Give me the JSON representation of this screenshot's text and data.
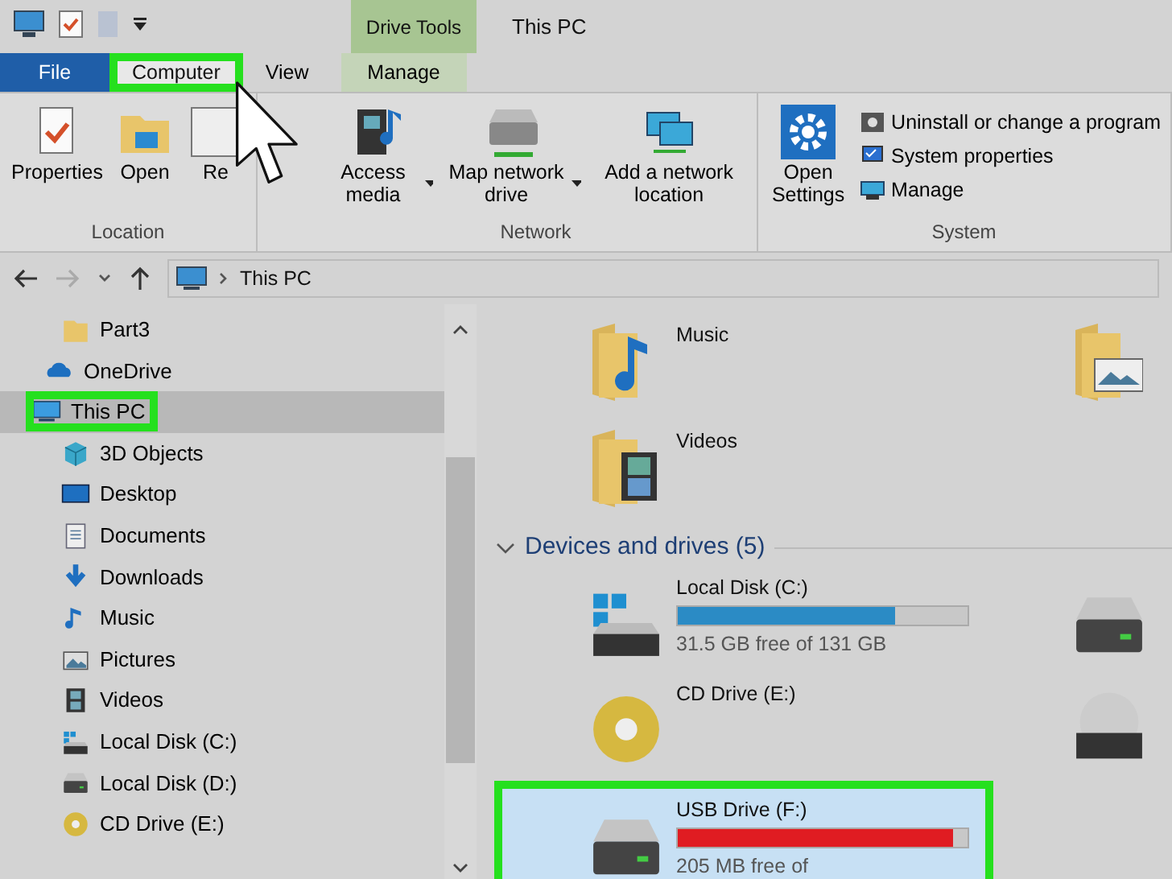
{
  "window": {
    "title": "This PC",
    "context_tab_group": "Drive Tools"
  },
  "tabs": [
    {
      "label": "File",
      "kind": "file",
      "selected": false,
      "highlighted": false
    },
    {
      "label": "Computer",
      "kind": "tab",
      "selected": true,
      "highlighted": true
    },
    {
      "label": "View",
      "kind": "tab",
      "selected": false,
      "highlighted": false
    },
    {
      "label": "Manage",
      "kind": "context",
      "selected": false,
      "highlighted": false
    }
  ],
  "ribbon": [
    {
      "name": "Location",
      "buttons": [
        {
          "label": "Properties",
          "kind": "properties"
        },
        {
          "label": "Open",
          "kind": "open"
        },
        {
          "label": "Re",
          "kind": "recent"
        }
      ]
    },
    {
      "name": "Network",
      "buttons": [
        {
          "label": "Access media",
          "kind": "media",
          "dropdown": true
        },
        {
          "label": "Map network drive",
          "kind": "netdrive",
          "dropdown": true
        },
        {
          "label": "Add a network location",
          "kind": "netloc",
          "dropdown": false
        }
      ]
    },
    {
      "name": "System",
      "buttons": [
        {
          "label": "Open Settings",
          "kind": "settings"
        }
      ],
      "small_buttons": [
        {
          "label": "Uninstall or change a program",
          "kind": "uninstall"
        },
        {
          "label": "System properties",
          "kind": "sysprops"
        },
        {
          "label": "Manage",
          "kind": "manage"
        }
      ]
    }
  ],
  "address": {
    "path": "This PC"
  },
  "sidebar": {
    "items": [
      {
        "label": "Part3",
        "kind": "folder",
        "selected": false,
        "highlighted": false
      },
      {
        "label": "OneDrive",
        "kind": "cloud",
        "selected": false,
        "highlighted": false
      },
      {
        "label": "This PC",
        "kind": "pc",
        "selected": true,
        "highlighted": true,
        "children": [
          {
            "label": "3D Objects",
            "kind": "cube",
            "selected": false,
            "highlighted": false
          },
          {
            "label": "Desktop",
            "kind": "desktop",
            "selected": false,
            "highlighted": false
          },
          {
            "label": "Documents",
            "kind": "documents",
            "selected": false,
            "highlighted": false
          },
          {
            "label": "Downloads",
            "kind": "download",
            "selected": false,
            "highlighted": false
          },
          {
            "label": "Music",
            "kind": "music",
            "selected": false,
            "highlighted": false
          },
          {
            "label": "Pictures",
            "kind": "pictures",
            "selected": false,
            "highlighted": false
          },
          {
            "label": "Videos",
            "kind": "videos",
            "selected": false,
            "highlighted": false
          },
          {
            "label": "Local Disk (C:)",
            "kind": "sysdisk",
            "selected": false,
            "highlighted": false
          },
          {
            "label": "Local Disk (D:)",
            "kind": "disk",
            "selected": false,
            "highlighted": false
          },
          {
            "label": "CD Drive (E:)",
            "kind": "cd",
            "selected": false,
            "highlighted": false
          }
        ]
      }
    ]
  },
  "folders": [
    {
      "label": "Music",
      "kind": "music"
    },
    {
      "kind": "pictures"
    },
    {
      "label": "Videos",
      "kind": "videos"
    }
  ],
  "devices": {
    "heading": "Devices and drives (5)",
    "expanded": true,
    "items": [
      {
        "label": "Local Disk (C:)",
        "kind": "sysdisk",
        "level": 0.75,
        "low_space": false,
        "free": "31.5 GB free of 131 GB",
        "highlighted": false
      },
      {
        "kind": "disk",
        "highlighted": false
      },
      {
        "label": "CD Drive (E:)",
        "kind": "cd",
        "highlighted": false
      },
      {
        "kind": "dvd",
        "highlighted": false
      },
      {
        "label": "USB Drive (F:)",
        "kind": "disk",
        "level": 0.95,
        "low_space": true,
        "free": "205 MB free of",
        "highlighted": true
      }
    ]
  }
}
